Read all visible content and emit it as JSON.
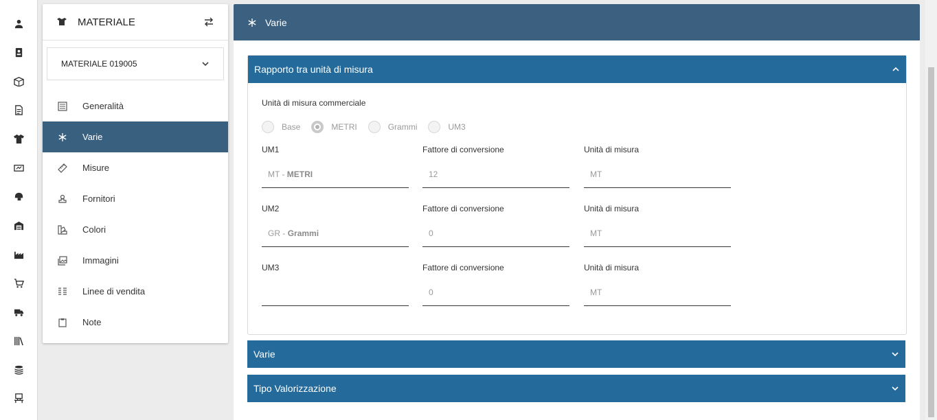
{
  "rail": {
    "icons": [
      "user-icon",
      "id-card-icon",
      "box-icon",
      "document-icon",
      "tshirt-icon",
      "ticket-icon",
      "hat-icon",
      "warehouse-icon",
      "factory-icon",
      "cart-icon",
      "truck-icon",
      "library-icon",
      "coins-icon",
      "workstation-icon"
    ]
  },
  "sidebar": {
    "title": "MATERIALE",
    "selected_material": "MATERIALE 019005",
    "items": [
      {
        "label": "Generalità"
      },
      {
        "label": "Varie"
      },
      {
        "label": "Misure"
      },
      {
        "label": "Fornitori"
      },
      {
        "label": "Colori"
      },
      {
        "label": "Immagini"
      },
      {
        "label": "Linee di vendita"
      },
      {
        "label": "Note"
      }
    ]
  },
  "main": {
    "title": "Varie",
    "panels": {
      "rapporto": {
        "title": "Rapporto tra unità di misura",
        "commercial_label": "Unità di misura commerciale",
        "radios": [
          {
            "label": "Base",
            "selected": false
          },
          {
            "label": "METRI",
            "selected": true
          },
          {
            "label": "Grammi",
            "selected": false
          },
          {
            "label": "UM3",
            "selected": false
          }
        ],
        "rows": [
          {
            "um_label": "UM1",
            "um_code": "MT - ",
            "um_name": "METRI",
            "factor_label": "Fattore di conversione",
            "factor": "12",
            "unit_label": "Unità di misura",
            "unit": "MT"
          },
          {
            "um_label": "UM2",
            "um_code": "GR - ",
            "um_name": "Grammi",
            "factor_label": "Fattore di conversione",
            "factor": "0",
            "unit_label": "Unità di misura",
            "unit": "MT"
          },
          {
            "um_label": "UM3",
            "um_code": "",
            "um_name": "",
            "factor_label": "Fattore di conversione",
            "factor": "0",
            "unit_label": "Unità di misura",
            "unit": "MT"
          }
        ]
      },
      "varie": {
        "title": "Varie"
      },
      "valorizzazione": {
        "title": "Tipo Valorizzazione"
      }
    }
  }
}
